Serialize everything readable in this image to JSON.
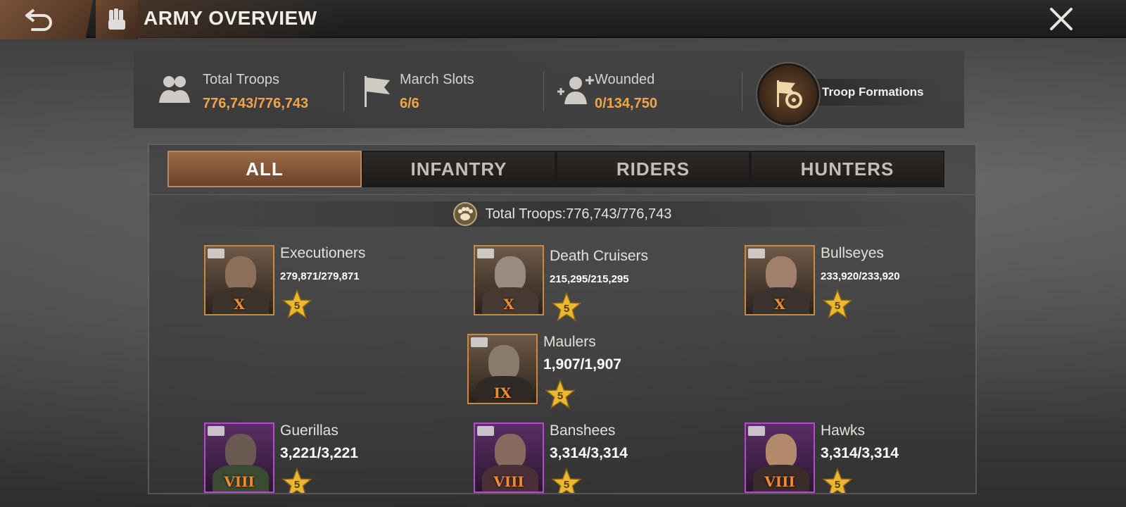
{
  "header": {
    "title": "ARMY OVERVIEW"
  },
  "stats": {
    "total_troops": {
      "label": "Total Troops",
      "value": "776,743/776,743"
    },
    "march_slots": {
      "label": "March Slots",
      "value": "6/6"
    },
    "wounded": {
      "label": "Wounded",
      "value": "0/134,750"
    },
    "formations_label": "Troop Formations"
  },
  "tabs": [
    {
      "label": "ALL",
      "active": true
    },
    {
      "label": "INFANTRY",
      "active": false
    },
    {
      "label": "RIDERS",
      "active": false
    },
    {
      "label": "HUNTERS",
      "active": false
    }
  ],
  "summary": {
    "text": "Total Troops:776,743/776,743"
  },
  "units": [
    {
      "name": "Executioners",
      "count": "279,871/279,871",
      "tier": "X",
      "stars": "5"
    },
    {
      "name": "Death Cruisers",
      "count": "215,295/215,295",
      "tier": "X",
      "stars": "5"
    },
    {
      "name": "Bullseyes",
      "count": "233,920/233,920",
      "tier": "X",
      "stars": "5"
    },
    {
      "name": "Maulers",
      "count": "1,907/1,907",
      "tier": "IX",
      "stars": "5"
    },
    {
      "name": "Guerillas",
      "count": "3,221/3,221",
      "tier": "VIII",
      "stars": "5"
    },
    {
      "name": "Banshees",
      "count": "3,314/3,314",
      "tier": "VIII",
      "stars": "5"
    },
    {
      "name": "Hawks",
      "count": "3,314/3,314",
      "tier": "VIII",
      "stars": "5"
    }
  ],
  "colors": {
    "accent": "#f0a54a",
    "tab_active": "#8a5a3a",
    "tier_gold": "#c9893f",
    "tier_purple": "#b44bcc"
  }
}
